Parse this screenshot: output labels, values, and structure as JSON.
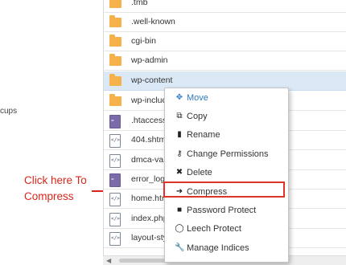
{
  "sidebar": {
    "partial_text": "cups"
  },
  "annotation": {
    "line1": "Click here To",
    "line2": "Compress",
    "color": "#d9261c"
  },
  "files": [
    {
      "name": ".tmb",
      "type": "folder"
    },
    {
      "name": ".well-known",
      "type": "folder"
    },
    {
      "name": "cgi-bin",
      "type": "folder"
    },
    {
      "name": "wp-admin",
      "type": "folder"
    },
    {
      "name": "wp-content",
      "type": "folder",
      "selected": true
    },
    {
      "name": "wp-incluc",
      "type": "folder"
    },
    {
      "name": ".htaccess",
      "type": "file-purple"
    },
    {
      "name": "404.shtm",
      "type": "file"
    },
    {
      "name": "dmca-va",
      "type": "file"
    },
    {
      "name": "error_log",
      "type": "file-purple"
    },
    {
      "name": "home.htr",
      "type": "file"
    },
    {
      "name": "index.php",
      "type": "file"
    },
    {
      "name": "layout-sty",
      "type": "file"
    }
  ],
  "context_menu": {
    "items": [
      {
        "label": "Move",
        "icon": "move-icon"
      },
      {
        "label": "Copy",
        "icon": "copy-icon"
      },
      {
        "label": "Rename",
        "icon": "rename-icon"
      },
      {
        "label": "Change Permissions",
        "icon": "key-icon"
      },
      {
        "label": "Delete",
        "icon": "delete-icon"
      },
      {
        "label": "Compress",
        "icon": "compress-icon",
        "highlighted": true
      },
      {
        "label": "Password Protect",
        "icon": "lock-icon"
      },
      {
        "label": "Leech Protect",
        "icon": "shield-icon"
      },
      {
        "label": "Manage Indices",
        "icon": "wrench-icon"
      }
    ]
  },
  "colors": {
    "accent": "#2f7bbf",
    "folder": "#f5b14a",
    "selected_row": "#dbe9f7",
    "highlight_border": "#e0342b"
  }
}
